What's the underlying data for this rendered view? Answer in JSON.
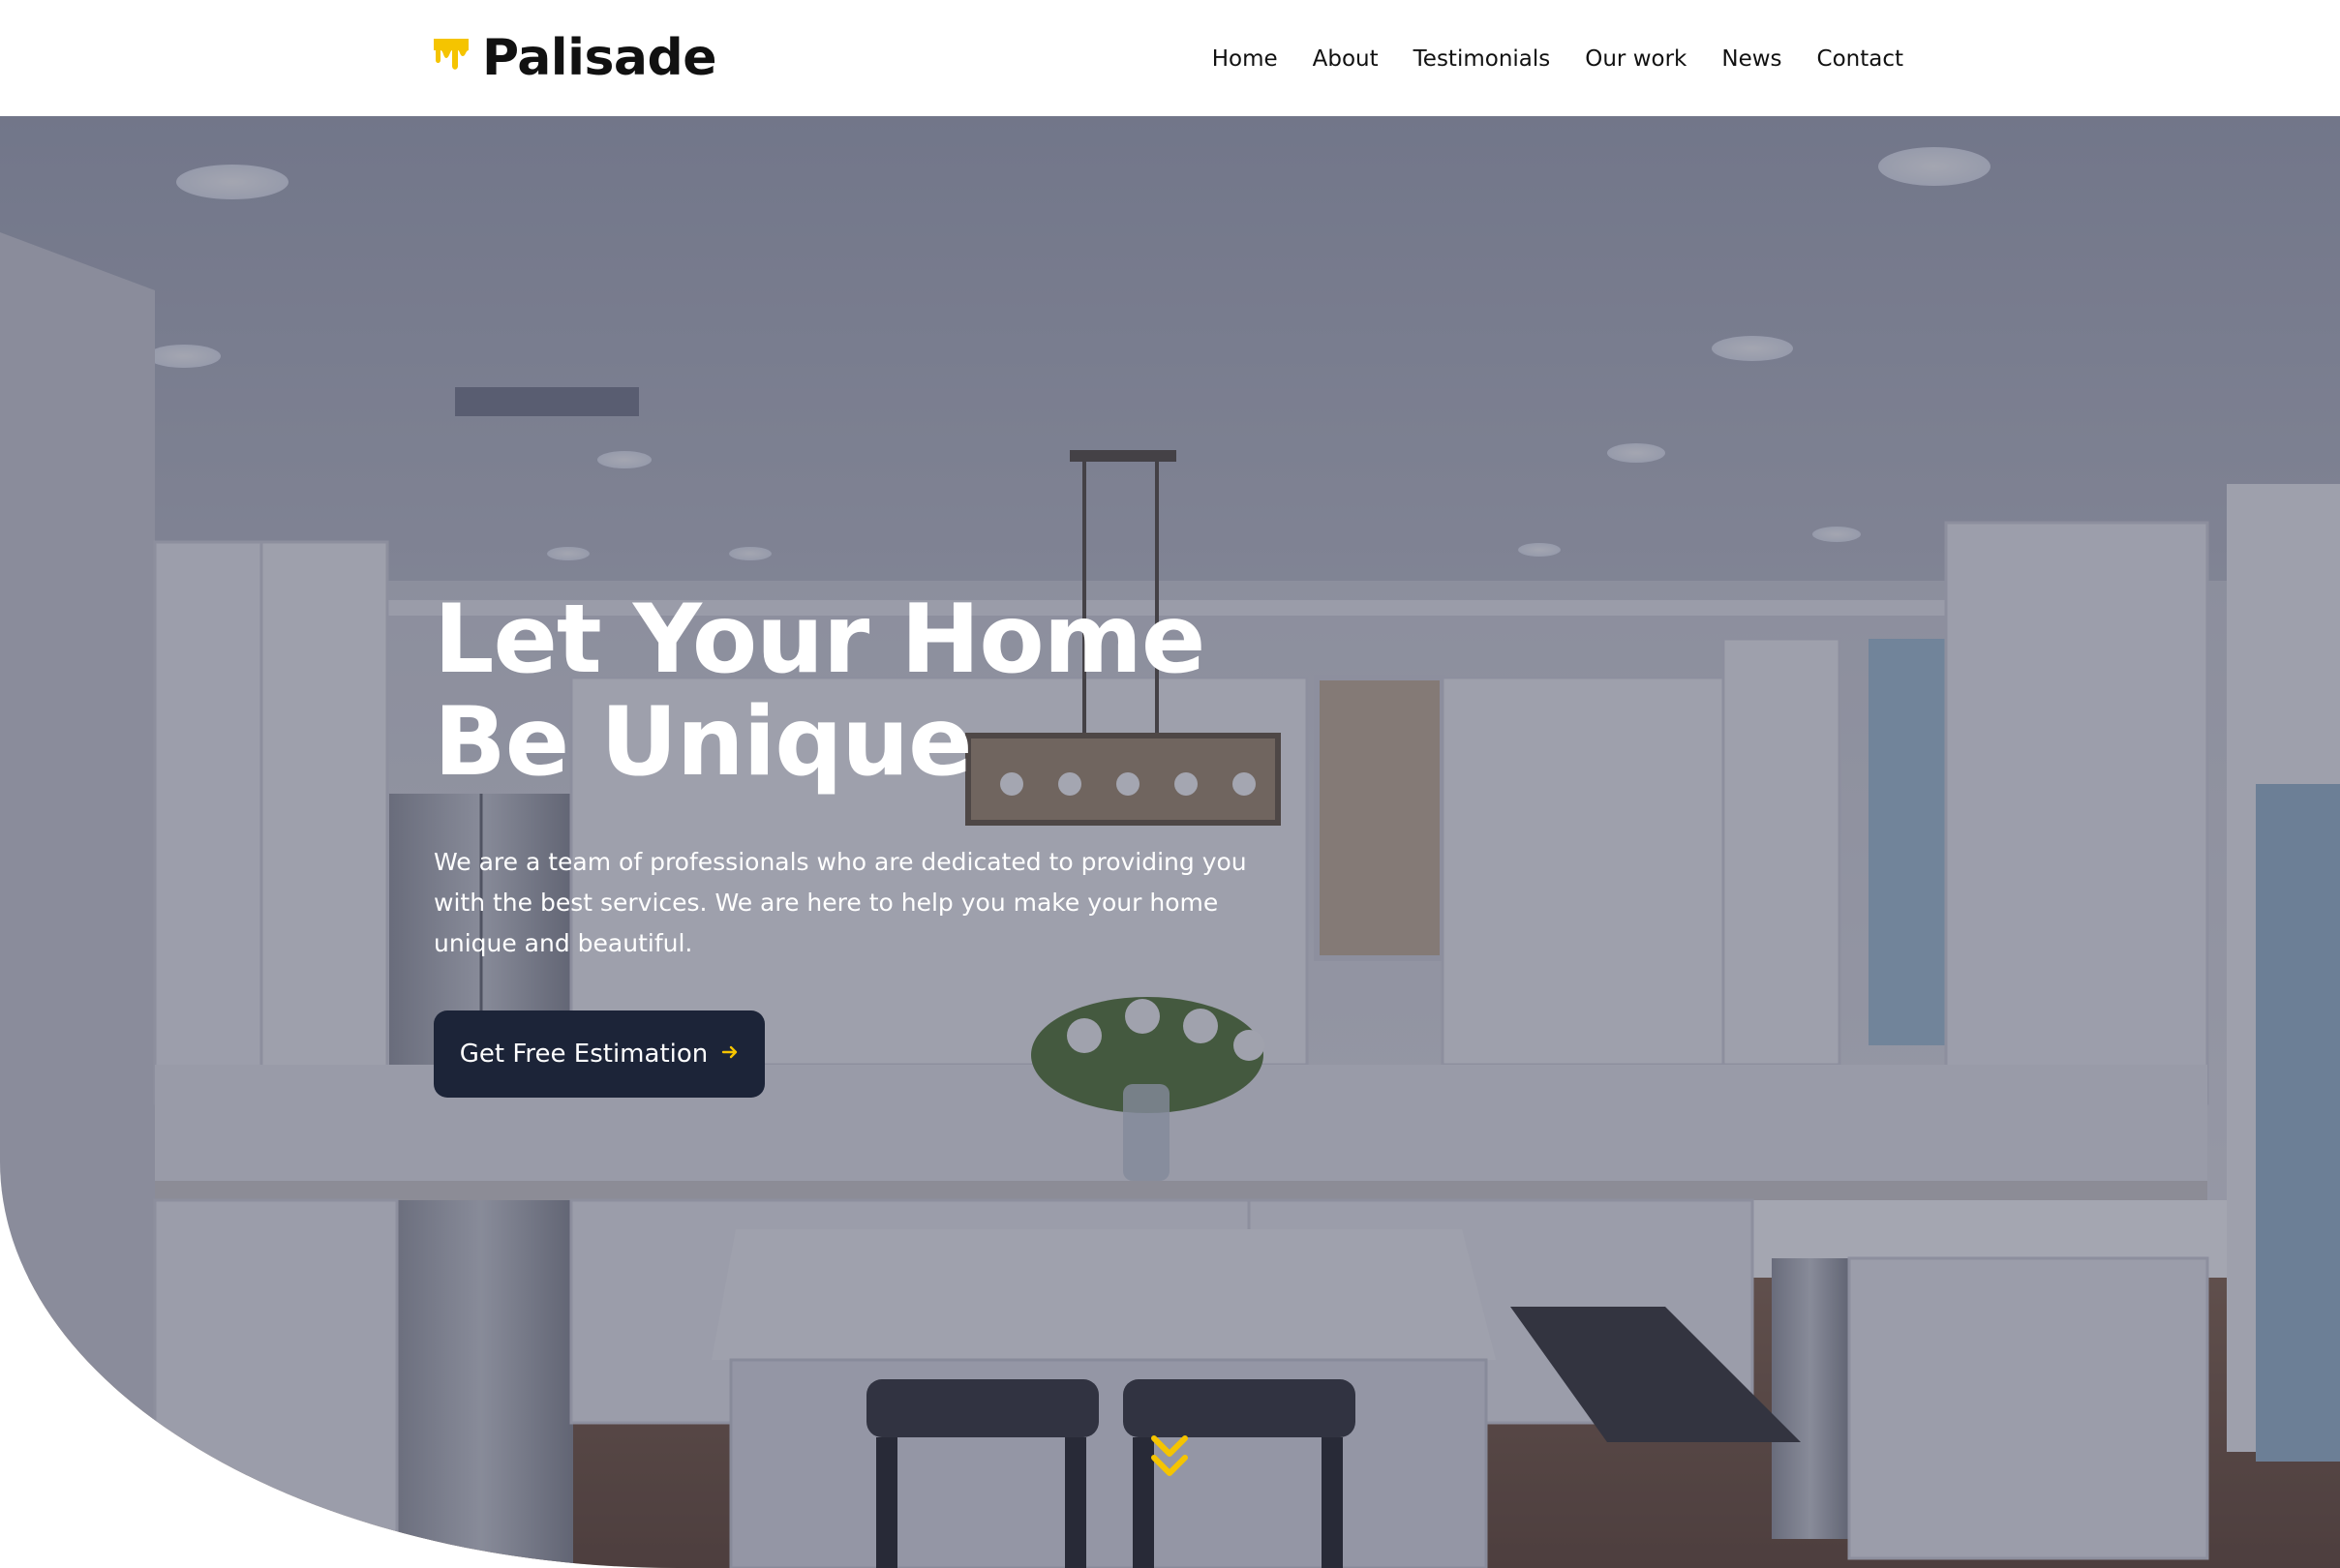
{
  "brand": {
    "name": "Palisade",
    "accent_color": "#f5c400",
    "logo_icon": "paint-drip-icon"
  },
  "nav": {
    "items": [
      {
        "label": "Home"
      },
      {
        "label": "About"
      },
      {
        "label": "Testimonials"
      },
      {
        "label": "Our work"
      },
      {
        "label": "News"
      },
      {
        "label": "Contact"
      }
    ]
  },
  "hero": {
    "headline_line1": "Let Your Home",
    "headline_line2": "Be Unique",
    "subtext": "We are a team of professionals who are dedicated to providing you with the best services. We are here to help you make your home unique and beautiful.",
    "cta_label": "Get Free Estimation",
    "cta_icon": "arrow-right-icon",
    "cta_color": "#1c2438",
    "scroll_icon": "double-chevron-down-icon",
    "background": "kitchen-photo"
  }
}
